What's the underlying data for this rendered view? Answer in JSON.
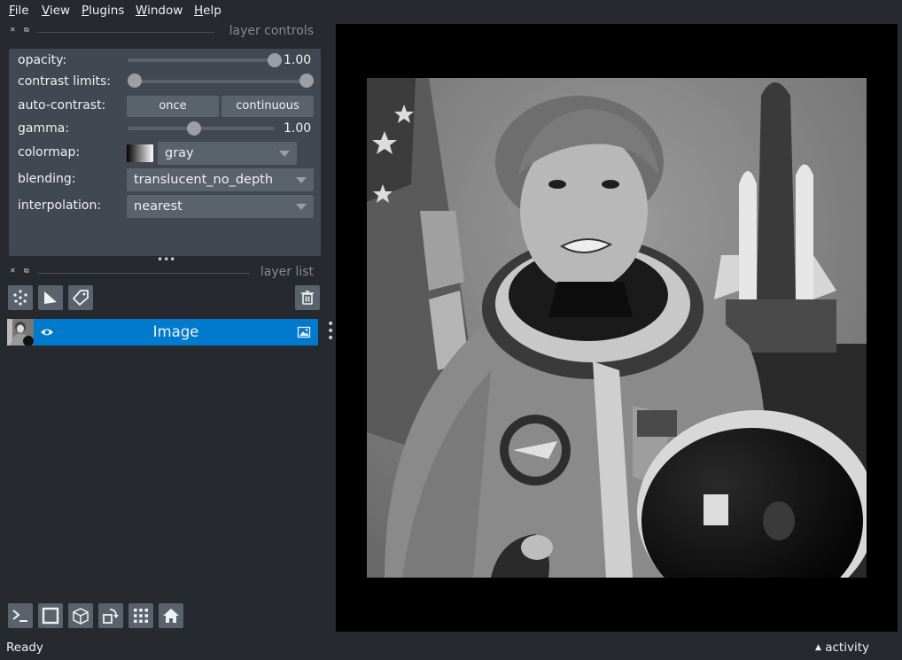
{
  "menu": {
    "file": "File",
    "file_rest": "ile",
    "file_key": "F",
    "view_key": "V",
    "view_rest": "iew",
    "plugins_key": "P",
    "plugins_rest": "lugins",
    "window_key": "W",
    "window_rest": "indow",
    "help_key": "H",
    "help_rest": "elp"
  },
  "layer_controls": {
    "title": "layer controls",
    "opacity_label": "opacity:",
    "opacity_value": "1.00",
    "opacity_level": 1.0,
    "contrast_label": "contrast limits:",
    "contrast_range": [
      0.0,
      1.0
    ],
    "auto_contrast_label": "auto-contrast:",
    "once_label": "once",
    "continuous_label": "continuous",
    "gamma_label": "gamma:",
    "gamma_value": "1.00",
    "gamma_level": 0.45,
    "colormap_label": "colormap:",
    "colormap_value": "gray",
    "blending_label": "blending:",
    "blending_value": "translucent_no_depth",
    "interpolation_label": "interpolation:",
    "interpolation_value": "nearest"
  },
  "layer_list": {
    "title": "layer list",
    "layers": [
      {
        "name": "Image",
        "visible": true
      }
    ]
  },
  "status": {
    "text": "Ready",
    "activity": "activity"
  },
  "icons": {
    "points": "points-icon",
    "shapes": "shapes-icon",
    "labels": "labels-icon",
    "delete": "trash-icon",
    "console": "console-icon",
    "ndisplay": "square-icon",
    "roll": "cube-icon",
    "transpose": "rotate-icon",
    "grid": "grid-icon",
    "home": "home-icon",
    "visibility": "eye-icon",
    "layer_type": "image-icon"
  },
  "colors": {
    "background": "#262930",
    "panel": "#414851",
    "control": "#5a626c",
    "selection": "#007acc",
    "canvas": "#000000"
  }
}
